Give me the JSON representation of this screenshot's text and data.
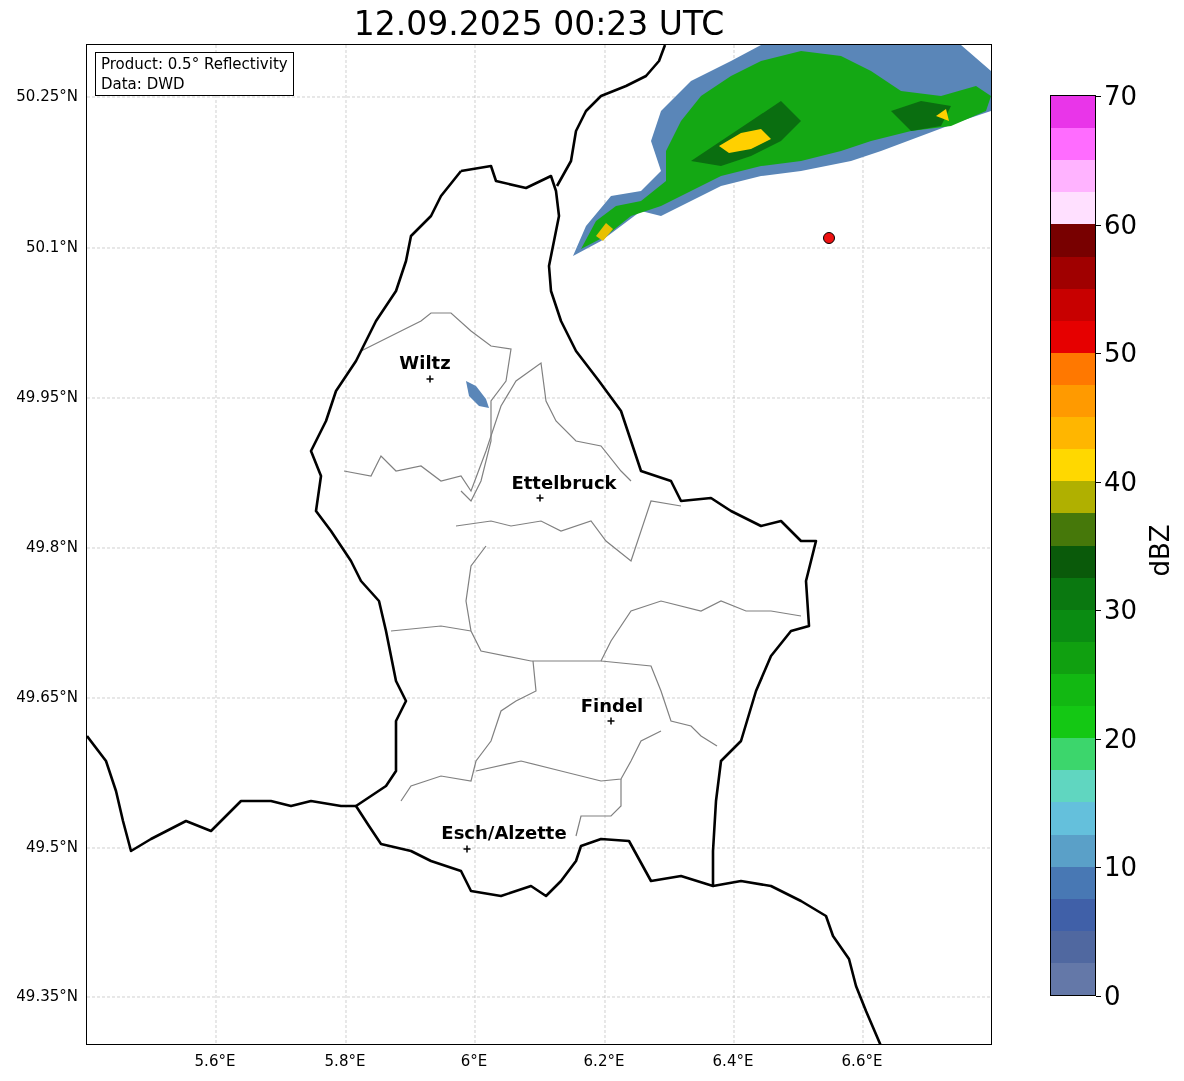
{
  "title": "12.09.2025 00:23 UTC",
  "info_box": [
    "Product: 0.5° Reflectivity",
    "Data: DWD"
  ],
  "x_ticks": [
    "5.6°E",
    "5.8°E",
    "6°E",
    "6.2°E",
    "6.4°E",
    "6.6°E"
  ],
  "y_ticks": [
    "50.25°N",
    "50.1°N",
    "49.95°N",
    "49.8°N",
    "49.65°N",
    "49.5°N",
    "49.35°N"
  ],
  "places": [
    {
      "name": "Wiltz"
    },
    {
      "name": "Ettelbruck"
    },
    {
      "name": "Findel"
    },
    {
      "name": "Esch/Alzette"
    }
  ],
  "colorbar": {
    "label": "dBZ",
    "ticks": [
      "70",
      "60",
      "50",
      "40",
      "30",
      "20",
      "10",
      "0"
    ],
    "bands": [
      {
        "color": "#e935e9"
      },
      {
        "color": "#ff6cff"
      },
      {
        "color": "#ffb3ff"
      },
      {
        "color": "#ffe0ff"
      },
      {
        "color": "#780000"
      },
      {
        "color": "#a00000"
      },
      {
        "color": "#c80000"
      },
      {
        "color": "#e60000"
      },
      {
        "color": "#ff7800"
      },
      {
        "color": "#ff9a00"
      },
      {
        "color": "#ffb600"
      },
      {
        "color": "#ffd800"
      },
      {
        "color": "#b0b000"
      },
      {
        "color": "#46780a"
      },
      {
        "color": "#0a5a0a"
      },
      {
        "color": "#0a7810"
      },
      {
        "color": "#0a8c12"
      },
      {
        "color": "#10a010"
      },
      {
        "color": "#12b812"
      },
      {
        "color": "#14c814"
      },
      {
        "color": "#3cd66c"
      },
      {
        "color": "#60d6c0"
      },
      {
        "color": "#64c0dc"
      },
      {
        "color": "#5aa0c8"
      },
      {
        "color": "#4878b4"
      },
      {
        "color": "#4060a8"
      },
      {
        "color": "#5068a0"
      },
      {
        "color": "#6478a8"
      }
    ]
  }
}
